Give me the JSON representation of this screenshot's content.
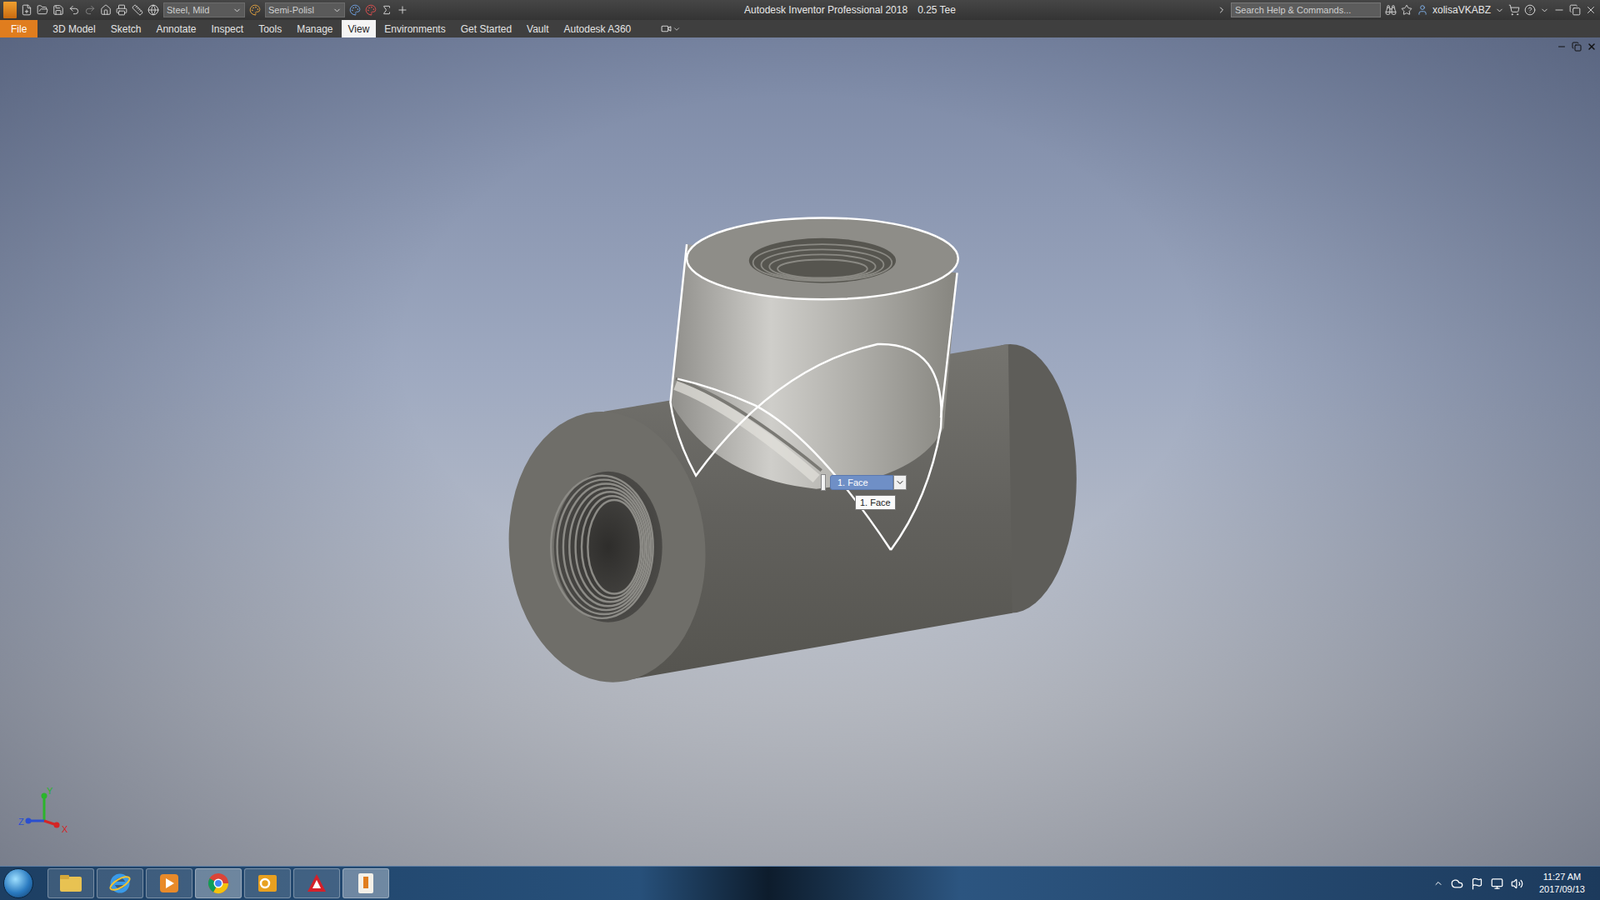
{
  "window": {
    "title": "Autodesk Inventor Professional 2018",
    "document": "0.25 Tee"
  },
  "quick_access": {
    "material": "Steel, Mild",
    "appearance": "Semi-Polisl"
  },
  "search": {
    "placeholder": "Search Help & Commands..."
  },
  "user": {
    "name": "xolisaVKABZ"
  },
  "tabs": [
    {
      "label": "File",
      "selected": false,
      "kind": "file"
    },
    {
      "label": "3D Model",
      "selected": false,
      "kind": "tab"
    },
    {
      "label": "Sketch",
      "selected": false,
      "kind": "tab"
    },
    {
      "label": "Annotate",
      "selected": false,
      "kind": "tab"
    },
    {
      "label": "Inspect",
      "selected": false,
      "kind": "tab"
    },
    {
      "label": "Tools",
      "selected": false,
      "kind": "tab"
    },
    {
      "label": "Manage",
      "selected": false,
      "kind": "tab"
    },
    {
      "label": "View",
      "selected": true,
      "kind": "tab"
    },
    {
      "label": "Environments",
      "selected": false,
      "kind": "tab"
    },
    {
      "label": "Get Started",
      "selected": false,
      "kind": "tab"
    },
    {
      "label": "Vault",
      "selected": false,
      "kind": "tab"
    },
    {
      "label": "Autodesk A360",
      "selected": false,
      "kind": "tab"
    }
  ],
  "viewport": {
    "selection_dropdown": "1. Face",
    "tooltip": "1. Face",
    "axes": [
      {
        "label": "Y",
        "color": "#2bb52b"
      },
      {
        "label": "Z",
        "color": "#2a4fd0"
      },
      {
        "label": "X",
        "color": "#d42525"
      }
    ]
  },
  "taskbar": {
    "time": "11:27 AM",
    "date": "2017/09/13"
  }
}
